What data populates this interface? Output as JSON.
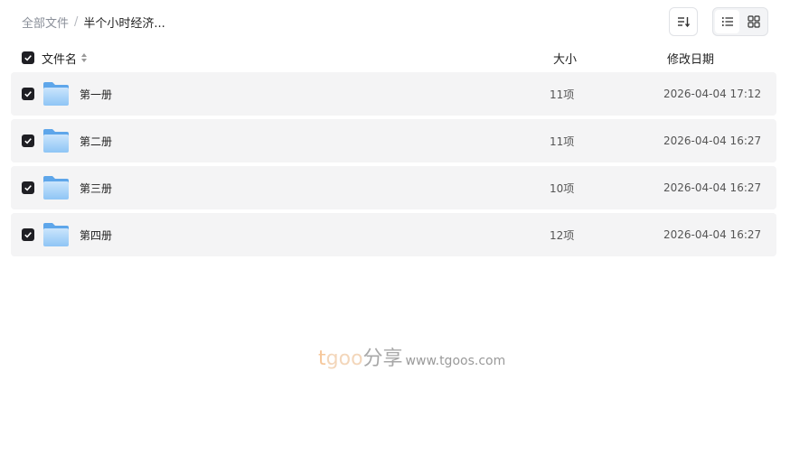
{
  "breadcrumb": {
    "root": "全部文件",
    "separator": "/",
    "current": "半个小时经济..."
  },
  "toolbar": {
    "sort_icon": "sort-icon",
    "list_view_icon": "list-view-icon",
    "grid_view_icon": "grid-view-icon"
  },
  "table": {
    "headers": {
      "name": "文件名",
      "size": "大小",
      "date": "修改日期"
    },
    "rows": [
      {
        "name": "第一册",
        "size": "11项",
        "date": "2026-04-04 17:12"
      },
      {
        "name": "第二册",
        "size": "11项",
        "date": "2026-04-04 16:27"
      },
      {
        "name": "第三册",
        "size": "10项",
        "date": "2026-04-04 16:27"
      },
      {
        "name": "第四册",
        "size": "12项",
        "date": "2026-04-04 16:27"
      }
    ]
  },
  "watermark": {
    "brand_t": "t",
    "brand_oo": "goo",
    "brand_cn": "分享",
    "url": "www.tgoos.com"
  },
  "colors": {
    "row_bg": "#f4f4f5",
    "checkbox": "#1f1f24",
    "folder": "#7ab6ee"
  }
}
